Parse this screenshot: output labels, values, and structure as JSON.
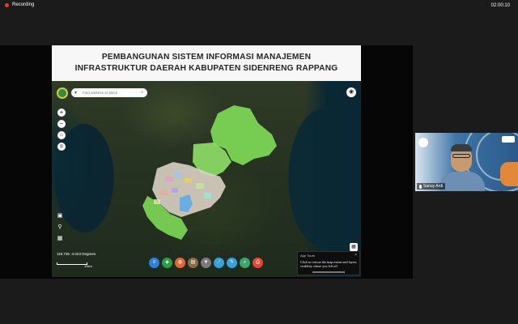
{
  "recording": {
    "label": "Recording",
    "timer": "02:00:10"
  },
  "banner": {
    "line1": "PEMBANGUNAN SISTEM INFORMASI MANAJEMEN",
    "line2": "INFRASTRUKTUR DAERAH KABUPATEN SIDENRENG RAPPANG"
  },
  "map": {
    "search_placeholder": "Find address or place",
    "zoom_in": "+",
    "zoom_out": "−",
    "coordinates": "119.736 -4.023 Degrees",
    "scale_label": "10km"
  },
  "popup": {
    "title": "App Tours",
    "body": "Click to restore the map extent and layers visibility where you left off",
    "close": "×"
  },
  "video": {
    "participant_name": "Sanuy Ardi"
  },
  "toolbar": {
    "buttons": [
      {
        "icon": "list-icon",
        "color": "#2f7fd6"
      },
      {
        "icon": "layers-icon",
        "color": "#2f9a4a"
      },
      {
        "icon": "basemap-icon",
        "color": "#e0693a"
      },
      {
        "icon": "stack-icon",
        "color": "#8a6b4c"
      },
      {
        "icon": "filter-icon",
        "color": "#7a7a7a"
      },
      {
        "icon": "measure-icon",
        "color": "#3aa0d8"
      },
      {
        "icon": "draw-icon",
        "color": "#3aa0d8"
      },
      {
        "icon": "search-icon",
        "color": "#3aa86a"
      },
      {
        "icon": "print-icon",
        "color": "#e04a3a"
      }
    ]
  },
  "colors": {
    "region_green": "#7ed957",
    "water": "#0a2834",
    "banner_bg": "#f7f7f7"
  }
}
